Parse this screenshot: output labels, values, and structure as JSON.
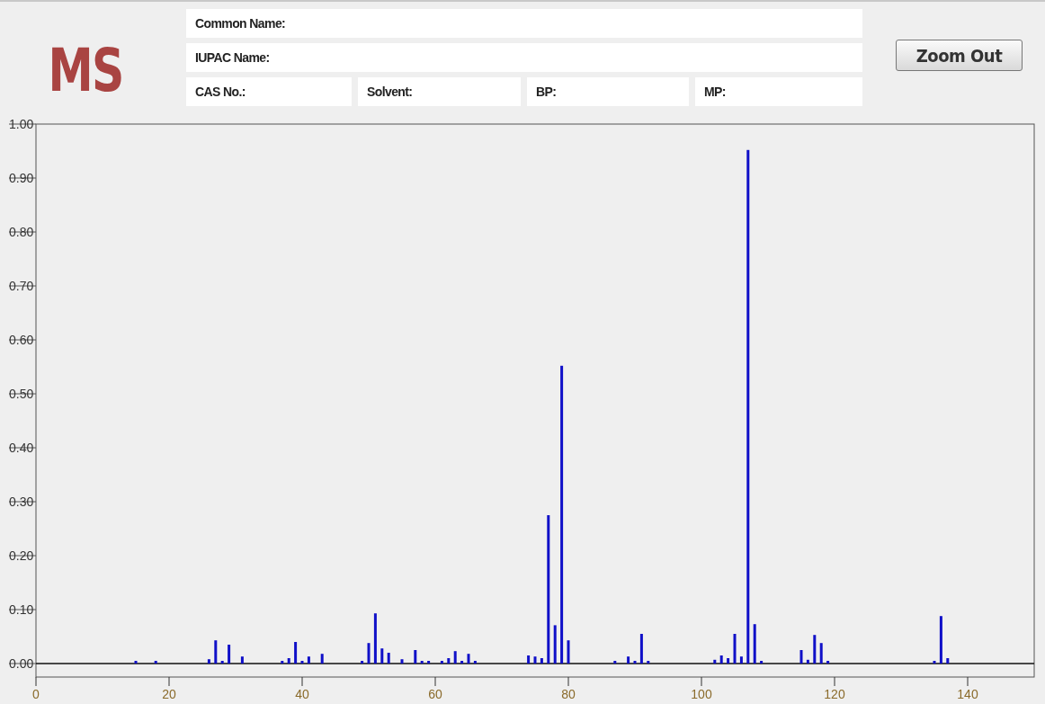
{
  "logo": "MS",
  "info_rows": [
    [
      {
        "label": "Common Name:"
      }
    ],
    [
      {
        "label": "IUPAC Name:"
      }
    ],
    [
      {
        "label": "CAS No.:"
      },
      {
        "label": "Solvent:"
      },
      {
        "label": "BP:"
      },
      {
        "label": "MP:"
      }
    ]
  ],
  "zoom_button": "Zoom Out",
  "spectrum": {
    "chart_data": {
      "type": "bar",
      "xlim": [
        0,
        150
      ],
      "ylim": [
        -0.025,
        1
      ],
      "xticks": [
        0,
        20,
        40,
        60,
        80,
        100,
        120,
        140
      ],
      "yticks": [
        {
          "value": 0,
          "label": "0.00"
        },
        {
          "value": 0.1,
          "label": "0.10"
        },
        {
          "value": 0.2,
          "label": "0.20"
        },
        {
          "value": 0.3,
          "label": "0.30"
        },
        {
          "value": 0.4,
          "label": "0.40"
        },
        {
          "value": 0.5,
          "label": "0.50"
        },
        {
          "value": 0.6,
          "label": "0.60"
        },
        {
          "value": 0.7,
          "label": "0.70"
        },
        {
          "value": 0.8,
          "label": "0.80"
        },
        {
          "value": 0.9,
          "label": "0.90"
        },
        {
          "value": 1,
          "label": "1.00"
        }
      ],
      "x": [
        15,
        18,
        26,
        27,
        28,
        29,
        31,
        37,
        38,
        39,
        40,
        41,
        43,
        49,
        50,
        51,
        52,
        53,
        55,
        57,
        58,
        59,
        61,
        62,
        63,
        64,
        65,
        66,
        74,
        75,
        76,
        77,
        78,
        79,
        80,
        87,
        89,
        90,
        91,
        92,
        102,
        103,
        104,
        105,
        106,
        107,
        108,
        109,
        115,
        116,
        117,
        118,
        119,
        135,
        136,
        137
      ],
      "series": [
        {
          "color": "#1010c8",
          "values": [
            0.005,
            0.005,
            0.008,
            0.043,
            0.005,
            0.035,
            0.013,
            0.005,
            0.01,
            0.04,
            0.005,
            0.013,
            0.018,
            0.005,
            0.038,
            0.093,
            0.028,
            0.02,
            0.008,
            0.025,
            0.005,
            0.005,
            0.005,
            0.01,
            0.023,
            0.005,
            0.018,
            0.005,
            0.015,
            0.013,
            0.01,
            0.275,
            0.071,
            0.552,
            0.043,
            0.005,
            0.013,
            0.005,
            0.055,
            0.005,
            0.007,
            0.015,
            0.01,
            0.055,
            0.013,
            0.952,
            0.073,
            0.005,
            0.025,
            0.007,
            0.053,
            0.038,
            0.005,
            0.005,
            0.088,
            0.01
          ]
        }
      ]
    }
  }
}
